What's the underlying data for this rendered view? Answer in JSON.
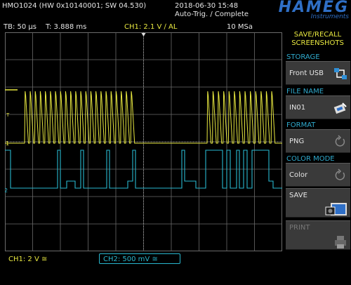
{
  "header": {
    "device": "HMO1024 (HW 0x10140001; SW 04.530)",
    "datetime": "2018-06-30 15:48",
    "mode": "Auto-Trig. / Complete",
    "logo_main": "HAMEG",
    "logo_sub": "Instruments"
  },
  "status": {
    "timebase": "TB: 50 µs",
    "trigger_time": "T: 3.888 ms",
    "ch1_trigger": "CH1: 2.1 V ∕ AL",
    "sample_rate": "10 MSa"
  },
  "bottom": {
    "ch1": "CH1: 2 V ≅",
    "ch2": "CH2: 500 mV ≅"
  },
  "menu": {
    "title_line1": "SAVE/RECALL",
    "title_line2": "SCREENSHOTS",
    "storage_label": "STORAGE",
    "storage_value": "Front USB",
    "filename_label": "FILE NAME",
    "filename_value": "IN01",
    "format_label": "FORMAT",
    "format_value": "PNG",
    "colormode_label": "COLOR MODE",
    "colormode_value": "Color",
    "save_label": "SAVE",
    "print_label": "PRINT"
  },
  "markers": {
    "ch1": "1",
    "ch2": "2",
    "trig": "T"
  },
  "colors": {
    "ch1": "#e8e840",
    "ch2": "#29b8cf",
    "grid": "#6b6b6b",
    "accent": "#2f6fc6"
  }
}
